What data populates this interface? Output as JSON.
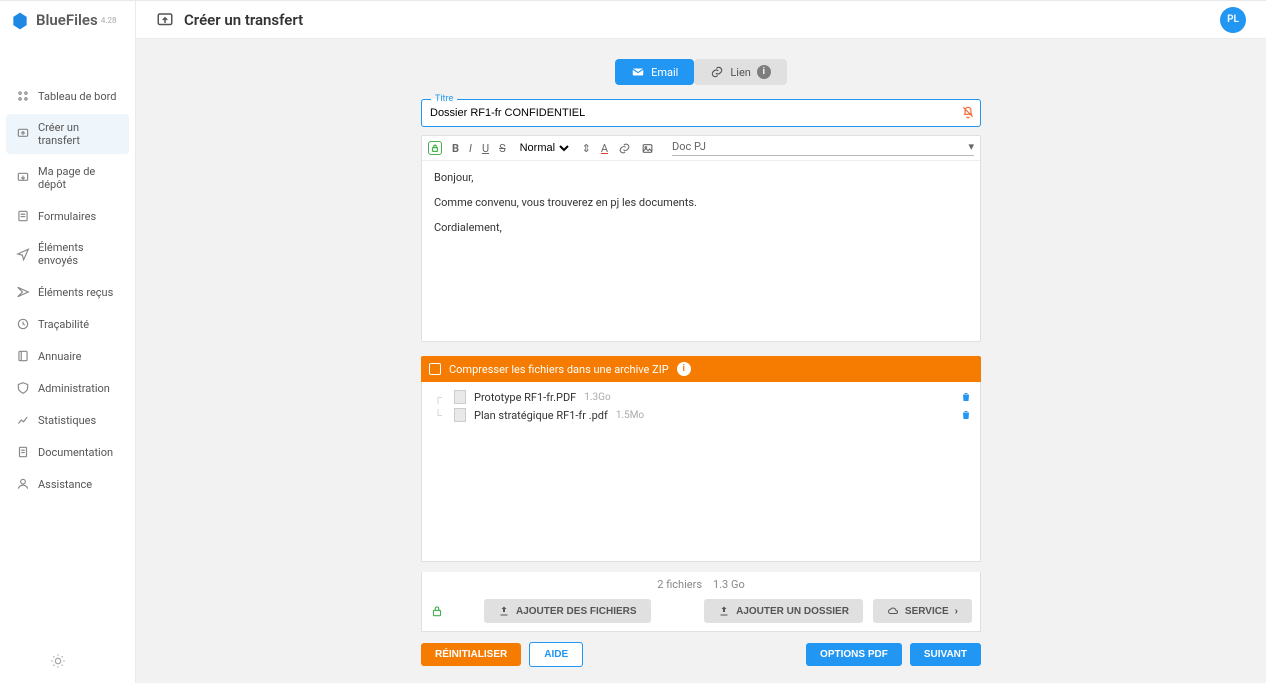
{
  "brand": {
    "name": "BlueFiles",
    "version": "4.28"
  },
  "header": {
    "title": "Créer un transfert"
  },
  "avatar": "PL",
  "sidebar": {
    "items": [
      {
        "label": "Tableau de bord"
      },
      {
        "label": "Créer un transfert"
      },
      {
        "label": "Ma page de dépôt"
      },
      {
        "label": "Formulaires"
      },
      {
        "label": "Éléments envoyés"
      },
      {
        "label": "Éléments reçus"
      },
      {
        "label": "Traçabilité"
      },
      {
        "label": "Annuaire"
      },
      {
        "label": "Administration"
      },
      {
        "label": "Statistiques"
      },
      {
        "label": "Documentation"
      },
      {
        "label": "Assistance"
      }
    ]
  },
  "tabs": {
    "email": "Email",
    "link": "Lien"
  },
  "titleField": {
    "label": "Titre",
    "value": "Dossier RF1-fr CONFIDENTIEL"
  },
  "editor": {
    "formatLabel": "Normal",
    "docPJ": "Doc PJ",
    "body": {
      "l1": "Bonjour,",
      "l2": "Comme convenu, vous trouverez en pj les documents.",
      "l3": "Cordialement,"
    }
  },
  "zipBar": {
    "label": "Compresser les fichiers dans une archive ZIP"
  },
  "files": [
    {
      "name": "Prototype RF1-fr.PDF",
      "size": "1.3Go"
    },
    {
      "name": "Plan stratégique RF1-fr .pdf",
      "size": "1.5Mo"
    }
  ],
  "fileStats": {
    "count": "2 fichiers",
    "total": "1.3 Go"
  },
  "fileButtons": {
    "addFiles": "AJOUTER DES FICHIERS",
    "addFolder": "AJOUTER UN DOSSIER",
    "service": "SERVICE"
  },
  "footer": {
    "reset": "RÉINITIALISER",
    "help": "AIDE",
    "options": "OPTIONS PDF",
    "next": "SUIVANT"
  }
}
